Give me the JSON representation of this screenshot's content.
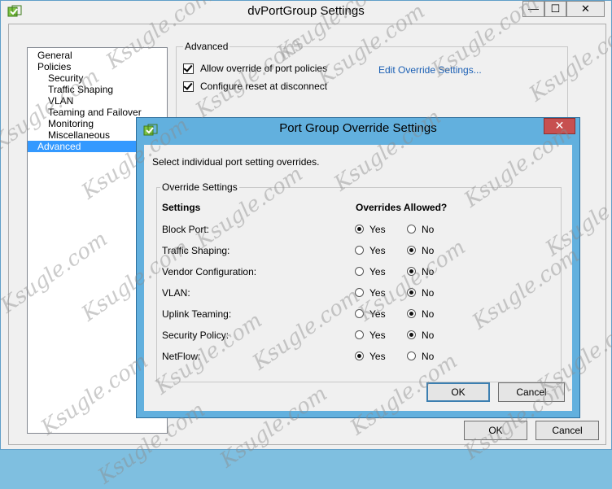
{
  "window": {
    "title": "dvPortGroup Settings",
    "min_glyph": "—",
    "max_glyph": "☐",
    "close_glyph": "✕"
  },
  "tree": {
    "items": [
      {
        "label": "General",
        "level": 0,
        "selected": false
      },
      {
        "label": "Policies",
        "level": 0,
        "selected": false
      },
      {
        "label": "Security",
        "level": 1,
        "selected": false
      },
      {
        "label": "Traffic Shaping",
        "level": 1,
        "selected": false
      },
      {
        "label": "VLAN",
        "level": 1,
        "selected": false
      },
      {
        "label": "Teaming and Failover",
        "level": 1,
        "selected": false
      },
      {
        "label": "Monitoring",
        "level": 1,
        "selected": false
      },
      {
        "label": "Miscellaneous",
        "level": 1,
        "selected": false
      },
      {
        "label": "Advanced",
        "level": 0,
        "selected": true
      }
    ]
  },
  "advanced": {
    "legend": "Advanced",
    "allow_override": {
      "label": "Allow override of port policies",
      "checked": true
    },
    "configure_reset": {
      "label": "Configure reset at disconnect",
      "checked": true
    },
    "edit_link": "Edit Override Settings..."
  },
  "main_buttons": {
    "ok": "OK",
    "cancel": "Cancel"
  },
  "dialog": {
    "title": "Port Group Override Settings",
    "close_glyph": "✕",
    "description": "Select individual port setting overrides.",
    "group_legend": "Override Settings",
    "col_settings": "Settings",
    "col_overrides": "Overrides Allowed?",
    "yes_label": "Yes",
    "no_label": "No",
    "rows": [
      {
        "label": "Block Port:",
        "yes": true
      },
      {
        "label": "Traffic Shaping:",
        "yes": false
      },
      {
        "label": "Vendor Configuration:",
        "yes": false
      },
      {
        "label": "VLAN:",
        "yes": false
      },
      {
        "label": "Uplink Teaming:",
        "yes": false
      },
      {
        "label": "Security Policy:",
        "yes": false
      },
      {
        "label": "NetFlow:",
        "yes": true
      }
    ],
    "ok": "OK",
    "cancel": "Cancel"
  },
  "watermark": "Ksugle.com",
  "colors": {
    "dialog_frame": "#62b0de",
    "selection": "#3399ff",
    "close_red": "#c75050",
    "link": "#1a5fb4"
  }
}
